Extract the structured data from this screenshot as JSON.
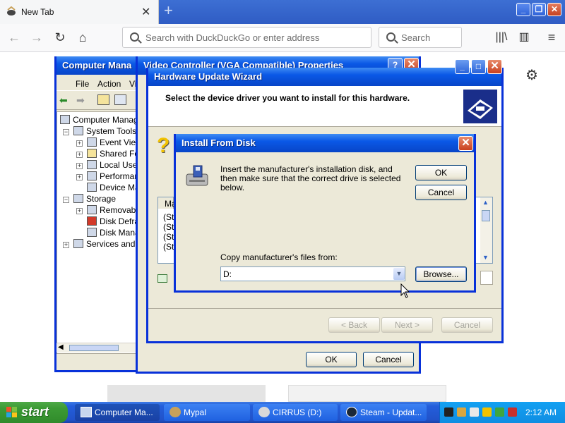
{
  "browser": {
    "tab_title": "New Tab",
    "url_placeholder": "Search with DuckDuckGo or enter address",
    "search_placeholder": "Search"
  },
  "computer_management": {
    "title": "Computer Mana",
    "menu": [
      "File",
      "Action",
      "Vie"
    ],
    "tree": [
      "Computer Manage",
      "System Tools",
      "Event View",
      "Shared Fol",
      "Local User",
      "Performan",
      "Device Ma",
      "Storage",
      "Removable",
      "Disk Defra",
      "Disk Manag",
      "Services and A"
    ]
  },
  "properties": {
    "title": "Video Controller (VGA Compatible) Properties",
    "ok": "OK",
    "cancel": "Cancel"
  },
  "wizard": {
    "title": "Hardware Update Wizard",
    "heading": "Select the device driver you want to install for this hardware.",
    "list_header": "Ma",
    "list_items": [
      "(St",
      "(St",
      "(St",
      "(St"
    ],
    "back": "< Back",
    "next": "Next >",
    "cancel": "Cancel"
  },
  "install_dialog": {
    "title": "Install From Disk",
    "message": "Insert the manufacturer's installation disk, and then make sure that the correct drive is selected below.",
    "ok": "OK",
    "cancel": "Cancel",
    "copy_label": "Copy manufacturer's files from:",
    "path_value": "D:",
    "browse": "Browse..."
  },
  "taskbar": {
    "start": "start",
    "buttons": [
      "Computer Ma...",
      "Mypal",
      "CIRRUS (D:)",
      "Steam - Updat..."
    ],
    "time": "2:12 AM"
  },
  "colors": {
    "xp_blue": "#0831d9",
    "xp_face": "#ece9d8",
    "start_green": "#3c9b35"
  }
}
